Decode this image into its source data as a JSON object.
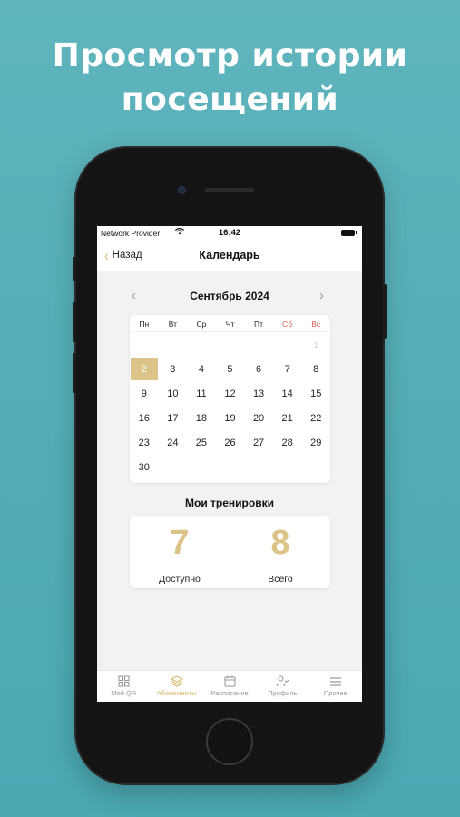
{
  "headline": {
    "line1": "Просмотр истории",
    "line2": "посещений"
  },
  "status_bar": {
    "carrier": "Network Provider",
    "time": "16:42"
  },
  "nav": {
    "back_label": "Назад",
    "title": "Календарь"
  },
  "calendar": {
    "month": "Сентябрь 2024",
    "weekdays": [
      "Пн",
      "Вт",
      "Ср",
      "Чт",
      "Пт",
      "Сб",
      "Вс"
    ],
    "weekend_color": "#e05a4c",
    "selected_color": "#dcc488",
    "leading_day": "1",
    "days": [
      "2",
      "3",
      "4",
      "5",
      "6",
      "7",
      "8",
      "9",
      "10",
      "11",
      "12",
      "13",
      "14",
      "15",
      "16",
      "17",
      "18",
      "19",
      "20",
      "21",
      "22",
      "23",
      "24",
      "25",
      "26",
      "27",
      "28",
      "29",
      "30"
    ],
    "selected_day": "2"
  },
  "trainings": {
    "title": "Мои тренировки",
    "available_value": "7",
    "available_label": "Доступно",
    "total_value": "8",
    "total_label": "Всего"
  },
  "tabs": [
    {
      "label": "Мой QR",
      "icon": "qr-grid-icon"
    },
    {
      "label": "Абонементы",
      "icon": "layers-icon",
      "active": true
    },
    {
      "label": "Расписание",
      "icon": "calendar-icon"
    },
    {
      "label": "Профиль",
      "icon": "profile-check-icon"
    },
    {
      "label": "Прочее",
      "icon": "menu-icon"
    }
  ],
  "accent_color": "#d8b86d"
}
